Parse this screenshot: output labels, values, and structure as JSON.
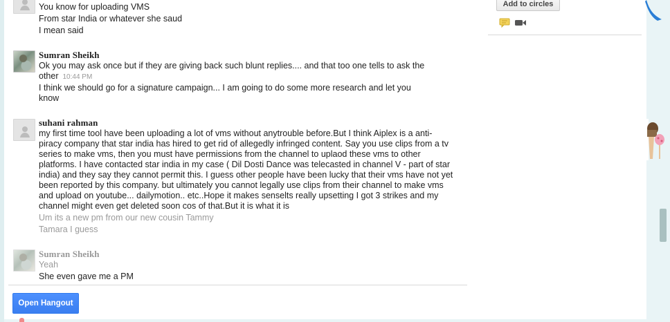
{
  "toolbar": {
    "add_to_circles": "Add to circles"
  },
  "messages": {
    "block1": {
      "lines": [
        "You know for uploading VMS",
        "From star India or whatever she saud",
        "I mean said"
      ]
    },
    "block2": {
      "author": "Sumran Sheikh",
      "line1": "Ok you may ask once but if they are giving back such blunt replies.... and that too one tells to ask the",
      "line2": "other",
      "timestamp": "10:44 PM",
      "line3": "I think we should go for a signature campaign... I am going to do some more research and let you",
      "line4": "know"
    },
    "block3": {
      "author": "suhani rahman",
      "lines": [
        "my first time tool have been uploading a lot of vms without anytrouble before.But I think Aiplex is a anti-",
        "piracy company that star india has hired to get rid of allegedly infringed content. Say you use clips from a tv",
        "series to make vms, then you must have permissions from the channel to uplaod these vms to other",
        "platforms. I have contacted star india in my case ( Dil Dosti Dance was telecasted in channel V - part of star",
        "india) and they say they cannot permit this. I guess other people have been lucky that their vms have not yet",
        "been reported by this company. but ultimately you cannot legally use clips from their channel to make vms",
        "and upload on youtube... dailymotion.. etc..Hope it makes senselts really upsetting I got 3 strikes and my",
        "channel might even get deleted soon cos of that.But it is what it is"
      ],
      "faded1": "Um its a new pm from our new cousin Tammy",
      "faded2": "Tamara I guess"
    },
    "block4": {
      "author": "Sumran Sheikh",
      "line1": "Yeah",
      "line2": "She even gave me a PM"
    }
  },
  "footer": {
    "open_hangout": "Open Hangout"
  },
  "icons": {
    "chat": "chat-bubble-icon",
    "video": "video-camera-icon"
  },
  "colors": {
    "hangout_button": "#4d90fe",
    "background": "#e9f4f6"
  }
}
